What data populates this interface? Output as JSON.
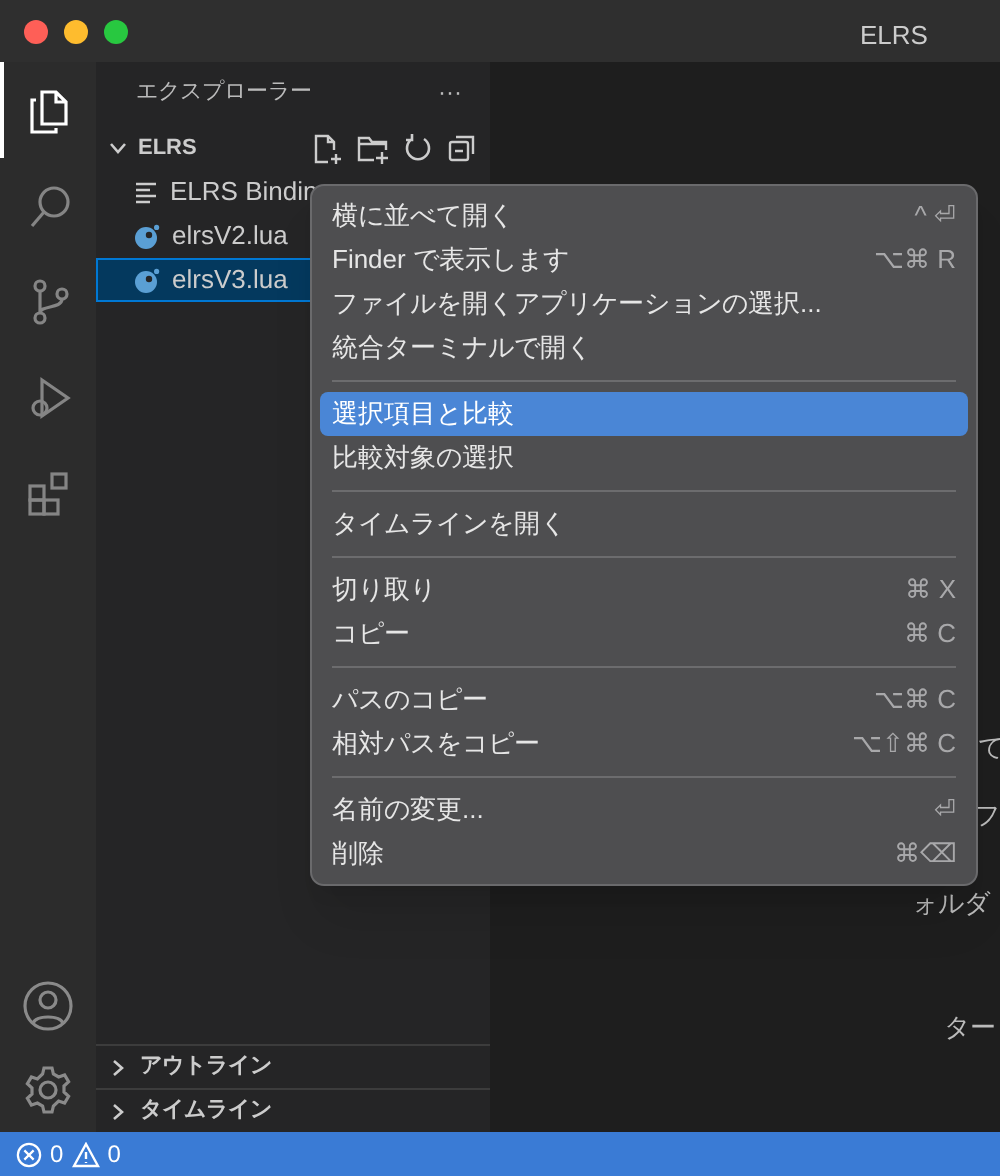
{
  "window": {
    "title": "ELRS"
  },
  "activity_bar": [
    {
      "kind": "files",
      "selected": true
    },
    {
      "kind": "search",
      "selected": false
    },
    {
      "kind": "scm",
      "selected": false
    },
    {
      "kind": "debug",
      "selected": false
    },
    {
      "kind": "extensions",
      "selected": false
    }
  ],
  "sidebar": {
    "title": "エクスプローラー",
    "more": "···",
    "folder": {
      "name": "ELRS",
      "expanded": true,
      "children": [
        {
          "name": "ELRS Bindin",
          "kind": "text",
          "selected": false
        },
        {
          "name": "elrsV2.lua",
          "kind": "lua",
          "selected": false
        },
        {
          "name": "elrsV3.lua",
          "kind": "lua",
          "selected": true
        }
      ]
    },
    "panels": [
      {
        "label": "アウトライン",
        "expanded": false
      },
      {
        "label": "タイムライン",
        "expanded": false
      }
    ]
  },
  "editor_fragments": [
    "て",
    "フ",
    "ォルダ",
    "ター"
  ],
  "context_menu": [
    {
      "kind": "item",
      "label": "横に並べて開く",
      "shortcut": "^ ⏎",
      "selected": false
    },
    {
      "kind": "item",
      "label": "Finder で表示します",
      "shortcut": "⌥⌘ R",
      "selected": false
    },
    {
      "kind": "item",
      "label": "ファイルを開くアプリケーションの選択...",
      "selected": false
    },
    {
      "kind": "item",
      "label": "統合ターミナルで開く",
      "selected": false
    },
    {
      "kind": "separator"
    },
    {
      "kind": "item",
      "label": "選択項目と比較",
      "selected": true
    },
    {
      "kind": "item",
      "label": "比較対象の選択",
      "selected": false
    },
    {
      "kind": "separator"
    },
    {
      "kind": "item",
      "label": "タイムラインを開く",
      "selected": false
    },
    {
      "kind": "separator"
    },
    {
      "kind": "item",
      "label": "切り取り",
      "shortcut": "⌘ X",
      "selected": false
    },
    {
      "kind": "item",
      "label": "コピー",
      "shortcut": "⌘ C",
      "selected": false
    },
    {
      "kind": "separator"
    },
    {
      "kind": "item",
      "label": "パスのコピー",
      "shortcut": "⌥⌘ C",
      "selected": false
    },
    {
      "kind": "item",
      "label": "相対パスをコピー",
      "shortcut": "⌥⇧⌘ C",
      "selected": false
    },
    {
      "kind": "separator"
    },
    {
      "kind": "item",
      "label": "名前の変更...",
      "shortcut": "⏎",
      "selected": false
    },
    {
      "kind": "item",
      "label": "削除",
      "shortcut": "⌘⌫",
      "selected": false
    }
  ],
  "status_bar": {
    "errors": "0",
    "warnings": "0"
  }
}
